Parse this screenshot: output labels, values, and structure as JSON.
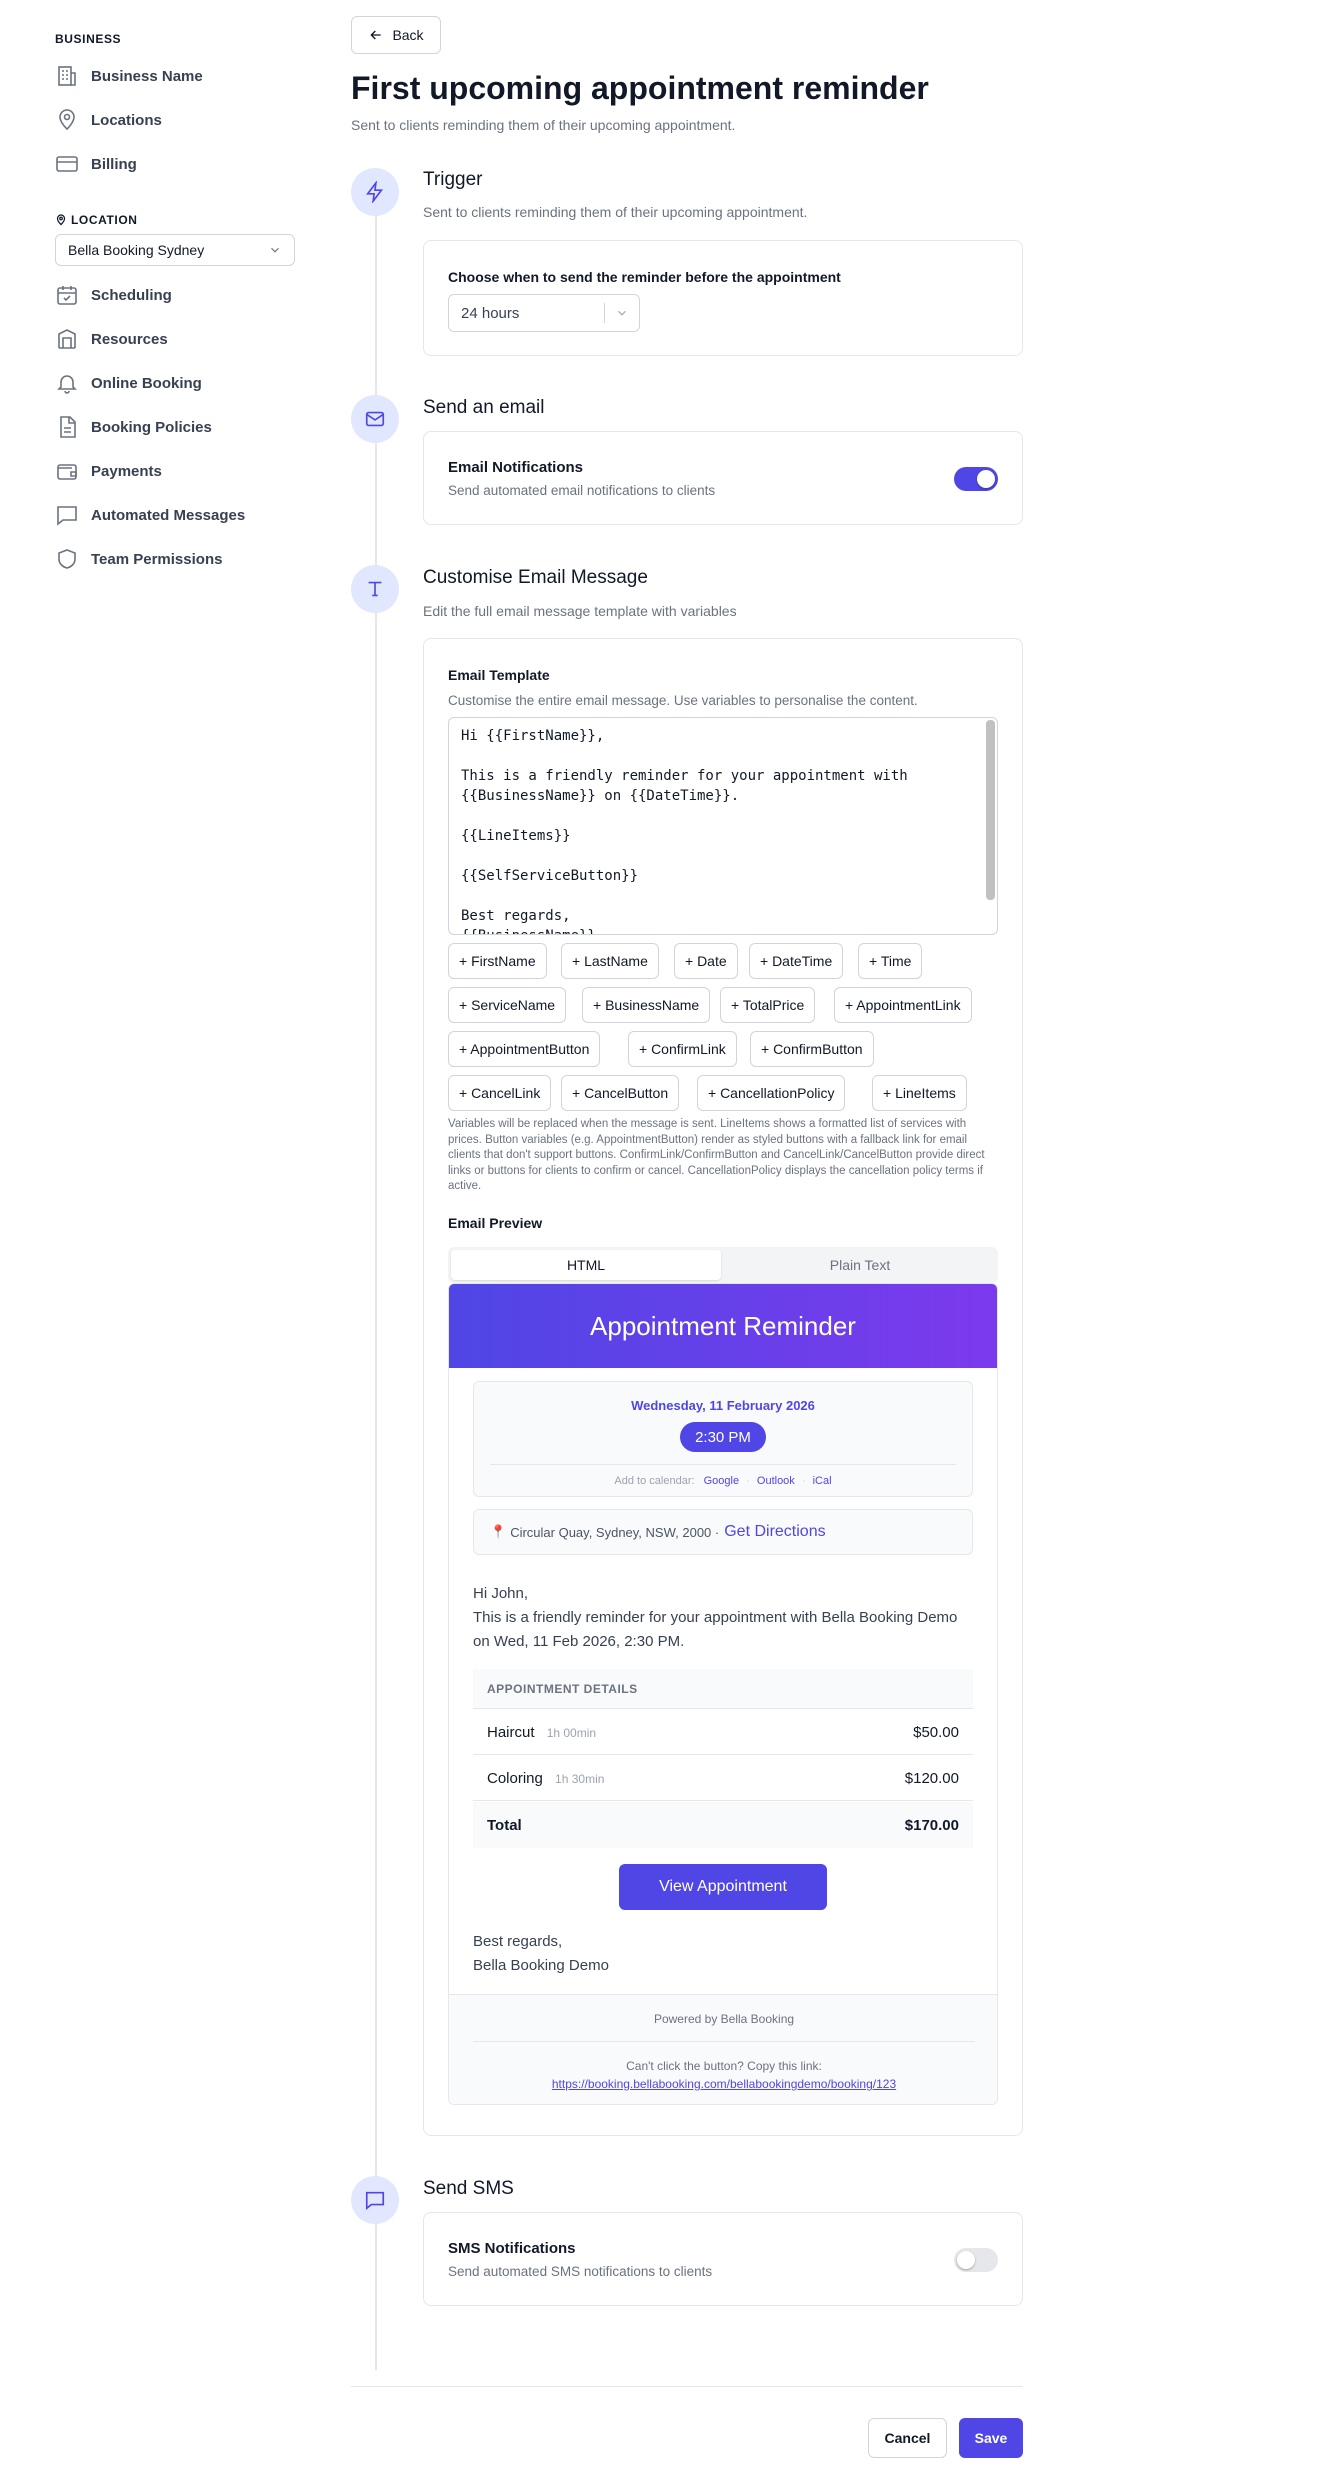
{
  "sidebar": {
    "business_heading": "BUSINESS",
    "business_items": [
      {
        "label": "Business Name"
      },
      {
        "label": "Locations"
      },
      {
        "label": "Billing"
      }
    ],
    "location_heading": "LOCATION",
    "location_select": "Bella Booking Sydney",
    "location_items": [
      {
        "label": "Scheduling"
      },
      {
        "label": "Resources"
      },
      {
        "label": "Online Booking"
      },
      {
        "label": "Booking Policies"
      },
      {
        "label": "Payments"
      },
      {
        "label": "Automated Messages"
      },
      {
        "label": "Team Permissions"
      }
    ]
  },
  "header": {
    "back": "Back",
    "title": "First upcoming appointment reminder",
    "subtitle": "Sent to clients reminding them of their upcoming appointment."
  },
  "trigger": {
    "title": "Trigger",
    "desc": "Sent to clients reminding them of their upcoming appointment.",
    "label": "Choose when to send the reminder before the appointment",
    "value": "24 hours"
  },
  "email_step": {
    "title": "Send an email",
    "card_title": "Email Notifications",
    "card_desc": "Send automated email notifications to clients",
    "enabled": true
  },
  "customise": {
    "title": "Customise Email Message",
    "desc": "Edit the full email message template with variables",
    "template_label": "Email Template",
    "template_desc": "Customise the entire email message. Use variables to personalise the content.",
    "template_text": "Hi {{FirstName}},\n\nThis is a friendly reminder for your appointment with\n{{BusinessName}} on {{DateTime}}.\n\n{{LineItems}}\n\n{{SelfServiceButton}}\n\nBest regards,\n{{BusinessName}}",
    "variables": [
      "+ FirstName",
      "+ LastName",
      "+ Date",
      "+ DateTime",
      "+ Time",
      "+ ServiceName",
      "+ BusinessName",
      "+ TotalPrice",
      "+ AppointmentLink",
      "+ AppointmentButton",
      "+ ConfirmLink",
      "+ ConfirmButton",
      "+ CancelLink",
      "+ CancelButton",
      "+ CancellationPolicy",
      "+ LineItems"
    ],
    "note": "Variables will be replaced when the message is sent. LineItems shows a formatted list of services with prices. Button variables (e.g. AppointmentButton) render as styled buttons with a fallback link for email clients that don't support buttons. ConfirmLink/ConfirmButton and CancelLink/CancelButton provide direct links or buttons for clients to confirm or cancel. CancellationPolicy displays the cancellation policy terms if active.",
    "preview_label": "Email Preview",
    "tabs": [
      "HTML",
      "Plain Text"
    ],
    "active_tab": "HTML"
  },
  "preview": {
    "header": "Appointment Reminder",
    "date": "Wednesday, 11 February 2026",
    "time": "2:30 PM",
    "add_cal": "Add to calendar:",
    "cal_links": [
      "Google",
      "Outlook",
      "iCal"
    ],
    "address": "Circular Quay, Sydney, NSW, 2000 ·",
    "directions": "Get Directions",
    "greeting": "Hi John,",
    "message": "This is a friendly reminder for your appointment with Bella Booking Demo on Wed, 11 Feb 2026, 2:30 PM.",
    "table_heading": "APPOINTMENT DETAILS",
    "items": [
      {
        "name": "Haircut",
        "duration": "1h 00min",
        "price": "$50.00"
      },
      {
        "name": "Coloring",
        "duration": "1h 30min",
        "price": "$120.00"
      }
    ],
    "total_label": "Total",
    "total": "$170.00",
    "button": "View Appointment",
    "regards": "Best regards,",
    "signature": "Bella Booking Demo",
    "powered": "Powered by Bella Booking",
    "fallback": "Can't click the button? Copy this link:",
    "link": "https://booking.bellabooking.com/bellabookingdemo/booking/123"
  },
  "sms": {
    "title": "Send SMS",
    "card_title": "SMS Notifications",
    "card_desc": "Send automated SMS notifications to clients",
    "enabled": false
  },
  "actions": {
    "cancel": "Cancel",
    "save": "Save"
  },
  "colors": {
    "accent": "#4f46e5",
    "accent2": "#7c3aed"
  }
}
